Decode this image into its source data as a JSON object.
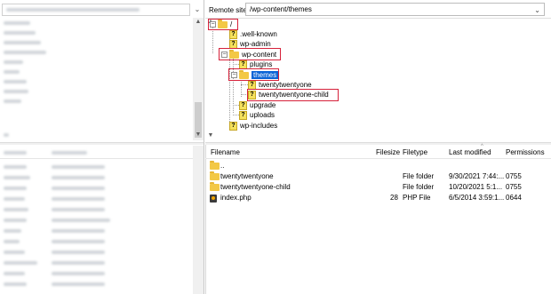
{
  "remote": {
    "label": "Remote site:",
    "path": "/wp-content/themes"
  },
  "tree": {
    "root": "/",
    "nodes": [
      {
        "label": ".well-known"
      },
      {
        "label": "wp-admin"
      },
      {
        "label": "wp-content"
      },
      {
        "label": "plugins"
      },
      {
        "label": "themes"
      },
      {
        "label": "twentytwentyone"
      },
      {
        "label": "twentytwentyone-child"
      },
      {
        "label": "upgrade"
      },
      {
        "label": "uploads"
      },
      {
        "label": "wp-includes"
      }
    ]
  },
  "list": {
    "columns": {
      "filename": "Filename",
      "filesize": "Filesize",
      "filetype": "Filetype",
      "modified": "Last modified",
      "permissions": "Permissions"
    },
    "rows": [
      {
        "name": "..",
        "size": "",
        "type": "",
        "modified": "",
        "perms": "",
        "icon": "folder-icon"
      },
      {
        "name": "twentytwentyone",
        "size": "",
        "type": "File folder",
        "modified": "9/30/2021 7:44:...",
        "perms": "0755",
        "icon": "folder-icon"
      },
      {
        "name": "twentytwentyone-child",
        "size": "",
        "type": "File folder",
        "modified": "10/20/2021 5:1...",
        "perms": "0755",
        "icon": "folder-icon"
      },
      {
        "name": "index.php",
        "size": "28",
        "type": "PHP File",
        "modified": "6/5/2014 3:59:1...",
        "perms": "0644",
        "icon": "php-file-icon"
      }
    ]
  },
  "colors": {
    "highlight_box": "#d6213a",
    "selection": "#0a64d6",
    "folder": "#f3c845"
  }
}
